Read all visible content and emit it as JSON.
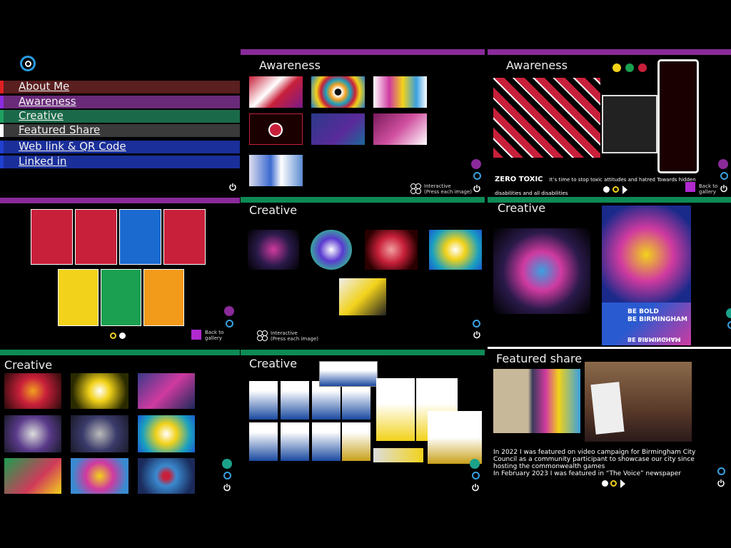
{
  "nav": {
    "items": [
      {
        "label": "About Me",
        "color": "#5a1f1f",
        "accent": "#e02020"
      },
      {
        "label": "Awareness",
        "color": "#6a2a7a",
        "accent": "#8a2be2"
      },
      {
        "label": "Creative",
        "color": "#1a6a4a",
        "accent": "#20a060"
      },
      {
        "label": "Featured Share",
        "color": "#3a3a3a",
        "accent": "#ffffff"
      },
      {
        "label": "Web link & QR Code",
        "color": "#1a2f9a",
        "accent": "#2040d0"
      },
      {
        "label": "Linked in",
        "color": "#1a2f9a",
        "accent": "#2040d0"
      }
    ]
  },
  "panels": {
    "awareness_gallery": {
      "title": "Awareness",
      "hint_line1": "Interactive",
      "hint_line2": "(Press each image)"
    },
    "awareness_detail": {
      "title": "Awareness",
      "banner_brand": "ZERO TOXIC",
      "banner_text": "It’s time to stop toxic attitudes and hatred Towards hidden disabilities and all disabilities",
      "back_line1": "Back to",
      "back_line2": "gallery"
    },
    "awareness_posters": {
      "back_line1": "Back to",
      "back_line2": "gallery"
    },
    "creative_gallery": {
      "title": "Creative",
      "hint_line1": "Interactive",
      "hint_line2": "(Press each image)"
    },
    "creative_detail": {
      "title": "Creative",
      "poster_line1": "BE BOLD",
      "poster_line2": "BE BIRMINGHAM",
      "poster_line3": "BE BIRMINGHAM"
    },
    "creative_grid": {
      "title": "Creative"
    },
    "creative_salsa": {
      "title": "Creative"
    },
    "featured": {
      "title": "Featured share",
      "caption_line1": "In 2022 I was featured on video campaign for Birmingham City",
      "caption_line2": "Council as a community participant to showcase our city since",
      "caption_line3": "hosting the commonwealth games",
      "caption_line4": "In February 2023 I was featured in “The Voice” newspaper"
    }
  },
  "colors": {
    "purple": "#8a2a9a",
    "green": "#0e8a55",
    "teal": "#1ba38a",
    "blue": "#3aa0e0",
    "yellow": "#f2d21a"
  }
}
